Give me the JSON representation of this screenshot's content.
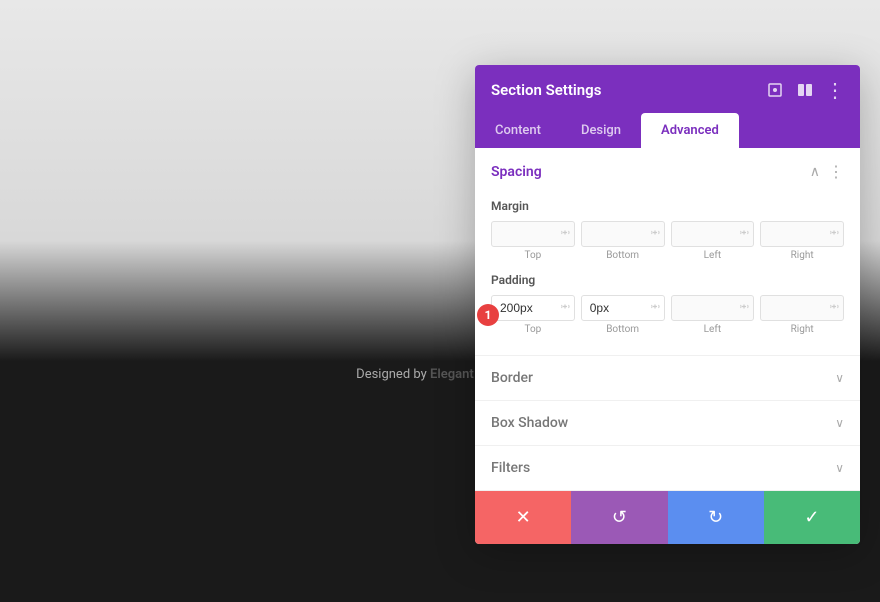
{
  "background": {
    "designed_by_text": "Designed by",
    "elegant_themes_text": "Elegant Themes"
  },
  "panel": {
    "title": "Section Settings",
    "close_icon": "✕",
    "header_icons": {
      "resize_icon": "⤢",
      "columns_icon": "▦",
      "more_icon": "⋮"
    },
    "tabs": [
      {
        "id": "content",
        "label": "Content",
        "active": false
      },
      {
        "id": "design",
        "label": "Design",
        "active": false
      },
      {
        "id": "advanced",
        "label": "Advanced",
        "active": true
      }
    ],
    "sections": [
      {
        "id": "spacing",
        "title": "Spacing",
        "collapsed": false,
        "fields": {
          "margin": {
            "label": "Margin",
            "inputs": [
              {
                "id": "margin-top",
                "value": "",
                "placeholder": "",
                "label": "Top"
              },
              {
                "id": "margin-bottom",
                "value": "",
                "placeholder": "",
                "label": "Bottom"
              },
              {
                "id": "margin-left",
                "value": "",
                "placeholder": "",
                "label": "Left"
              },
              {
                "id": "margin-right",
                "value": "",
                "placeholder": "",
                "label": "Right"
              }
            ]
          },
          "padding": {
            "label": "Padding",
            "badge": "1",
            "inputs": [
              {
                "id": "padding-top",
                "value": "200px",
                "placeholder": "",
                "label": "Top"
              },
              {
                "id": "padding-bottom",
                "value": "0px",
                "placeholder": "",
                "label": "Bottom"
              },
              {
                "id": "padding-left",
                "value": "",
                "placeholder": "",
                "label": "Left"
              },
              {
                "id": "padding-right",
                "value": "",
                "placeholder": "",
                "label": "Right"
              }
            ]
          }
        }
      },
      {
        "id": "border",
        "title": "Border",
        "collapsed": true
      },
      {
        "id": "box-shadow",
        "title": "Box Shadow",
        "collapsed": true
      },
      {
        "id": "filters",
        "title": "Filters",
        "collapsed": true
      }
    ],
    "footer": {
      "cancel_icon": "✕",
      "undo_icon": "↺",
      "redo_icon": "↻",
      "save_icon": "✓"
    }
  }
}
